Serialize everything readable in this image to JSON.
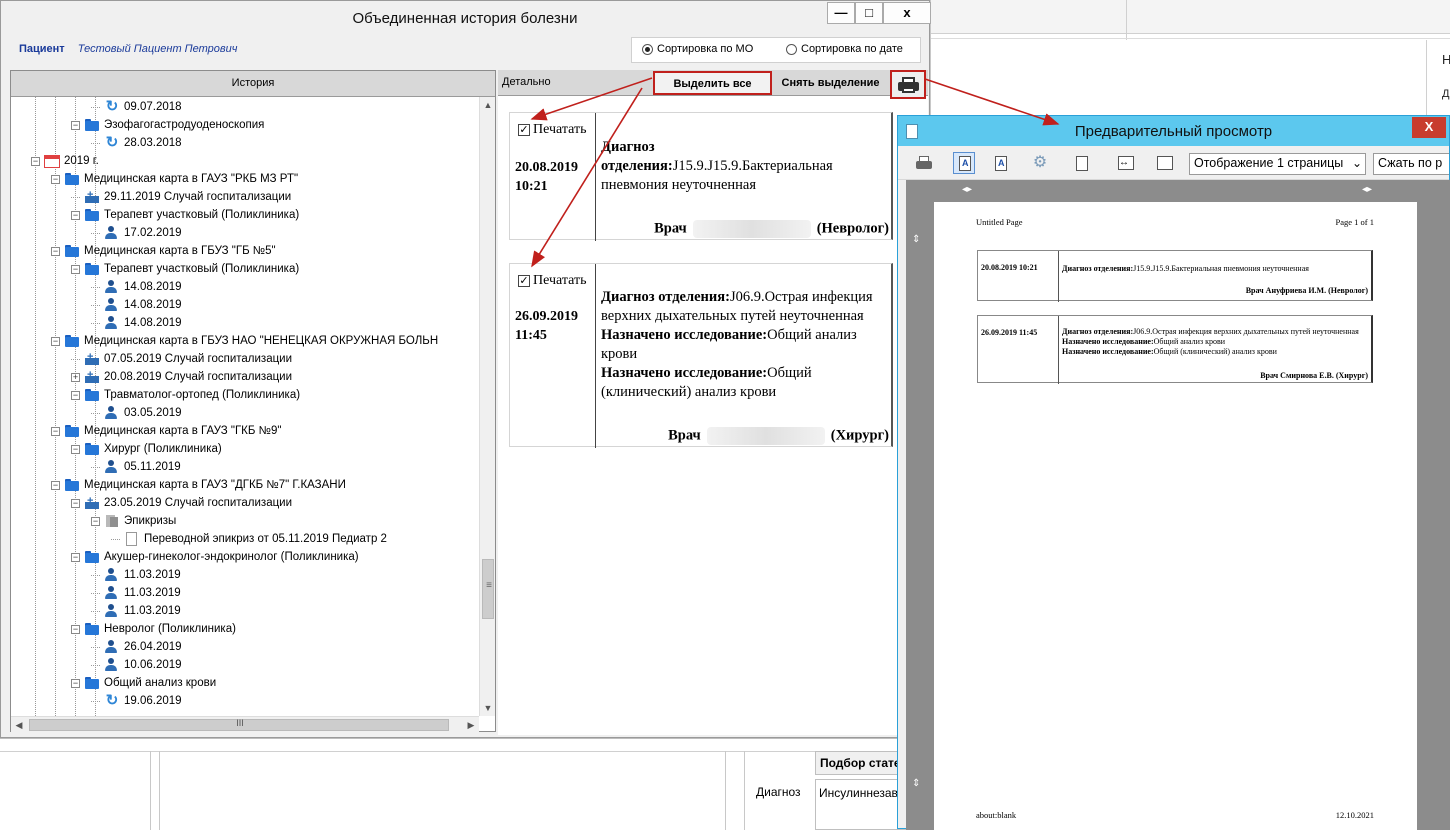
{
  "background": {
    "right_letters": [
      "Н",
      "Д"
    ],
    "bottom_header": "Подбор статей",
    "bottom_label": "Диагноз",
    "bottom_value": "Инсулиннезависимый"
  },
  "main_window": {
    "title": "Объединенная история болезни",
    "controls": {
      "minimize": "—",
      "maximize": "□",
      "close": "x"
    },
    "patient_label": "Пациент",
    "patient_name": "Тестовый Пациент Петрович",
    "sort": {
      "by_mo": "Сортировка по МО",
      "by_date": "Сортировка по дате",
      "selected": "by_mo"
    },
    "history_header": "История",
    "tree": [
      {
        "level": 4,
        "icon": "refresh",
        "text": "09.07.2018"
      },
      {
        "level": 3,
        "icon": "folder",
        "exp": "−",
        "text": "Эзофагогастродуоденоскопия"
      },
      {
        "level": 4,
        "icon": "refresh",
        "text": "28.03.2018"
      },
      {
        "level": 1,
        "icon": "cal",
        "exp": "−",
        "text": "2019 г."
      },
      {
        "level": 2,
        "icon": "folder",
        "exp": "−",
        "text": "Медицинская карта в ГАУЗ \"РКБ МЗ РТ\""
      },
      {
        "level": 3,
        "icon": "hosp",
        "text": "29.11.2019 Случай госпитализации"
      },
      {
        "level": 3,
        "icon": "folder",
        "exp": "−",
        "text": "Терапевт участковый (Поликлиника)"
      },
      {
        "level": 4,
        "icon": "person",
        "text": "17.02.2019"
      },
      {
        "level": 2,
        "icon": "folder",
        "exp": "−",
        "text": "Медицинская карта в ГБУЗ \"ГБ №5\""
      },
      {
        "level": 3,
        "icon": "folder",
        "exp": "−",
        "text": "Терапевт участковый (Поликлиника)"
      },
      {
        "level": 4,
        "icon": "person",
        "text": "14.08.2019"
      },
      {
        "level": 4,
        "icon": "person",
        "text": "14.08.2019"
      },
      {
        "level": 4,
        "icon": "person",
        "text": "14.08.2019"
      },
      {
        "level": 2,
        "icon": "folder",
        "exp": "−",
        "text": "Медицинская карта в ГБУЗ НАО \"НЕНЕЦКАЯ ОКРУЖНАЯ БОЛЬН"
      },
      {
        "level": 3,
        "icon": "hosp",
        "text": "07.05.2019 Случай госпитализации"
      },
      {
        "level": 3,
        "icon": "hosp",
        "exp": "+",
        "text": "20.08.2019 Случай госпитализации"
      },
      {
        "level": 3,
        "icon": "folder",
        "exp": "−",
        "text": "Травматолог-ортопед (Поликлиника)"
      },
      {
        "level": 4,
        "icon": "person",
        "text": "03.05.2019"
      },
      {
        "level": 2,
        "icon": "folder",
        "exp": "−",
        "text": "Медицинская карта в ГАУЗ \"ГКБ №9\""
      },
      {
        "level": 3,
        "icon": "folder",
        "exp": "−",
        "text": "Хирург (Поликлиника)"
      },
      {
        "level": 4,
        "icon": "person",
        "text": "05.11.2019"
      },
      {
        "level": 2,
        "icon": "folder",
        "exp": "−",
        "text": "Медицинская карта в ГАУЗ \"ДГКБ №7\" Г.КАЗАНИ"
      },
      {
        "level": 3,
        "icon": "hosp",
        "exp": "−",
        "text": "23.05.2019 Случай госпитализации"
      },
      {
        "level": 4,
        "icon": "docs",
        "exp": "−",
        "text": "Эпикризы"
      },
      {
        "level": 5,
        "icon": "page",
        "text": "Переводной эпикриз от 05.11.2019 Педиатр 2"
      },
      {
        "level": 3,
        "icon": "folder",
        "exp": "−",
        "text": "Акушер-гинеколог-эндокринолог (Поликлиника)"
      },
      {
        "level": 4,
        "icon": "person",
        "text": "11.03.2019"
      },
      {
        "level": 4,
        "icon": "person",
        "text": "11.03.2019"
      },
      {
        "level": 4,
        "icon": "person",
        "text": "11.03.2019"
      },
      {
        "level": 3,
        "icon": "folder",
        "exp": "−",
        "text": "Невролог (Поликлиника)"
      },
      {
        "level": 4,
        "icon": "person",
        "text": "26.04.2019"
      },
      {
        "level": 4,
        "icon": "person",
        "text": "10.06.2019"
      },
      {
        "level": 3,
        "icon": "folder",
        "exp": "−",
        "text": "Общий анализ крови"
      },
      {
        "level": 4,
        "icon": "refresh",
        "text": "19.06.2019"
      }
    ],
    "hscroll_grip": "III",
    "vscroll_grip": "≡",
    "detail": {
      "header": "Детально",
      "select_all": "Выделить все",
      "clear_selection": "Снять выделение",
      "cards": [
        {
          "print_label": "Печатать",
          "date": "20.08.2019",
          "time": "10:21",
          "lines": [
            {
              "bold": "Диагноз отделения:",
              "text": "J15.9.J15.9.Бактериальная пневмония неуточненная"
            }
          ],
          "doctor_prefix": "Врач",
          "doctor_role": "(Невролог)"
        },
        {
          "print_label": "Печатать",
          "date": "26.09.2019",
          "time": "11:45",
          "lines": [
            {
              "bold": "Диагноз отделения:",
              "text": "J06.9.Острая инфекция верхних дыхательных путей неуточненная"
            },
            {
              "bold": "Назначено исследование:",
              "text": "Общий анализ крови"
            },
            {
              "bold": "Назначено исследование:",
              "text": "Общий (клинический) анализ крови"
            }
          ],
          "doctor_prefix": "Врач",
          "doctor_role": "(Хирург)"
        }
      ]
    }
  },
  "preview": {
    "title": "Предварительный просмотр",
    "close": "X",
    "view_mode": "Отображение 1 страницы",
    "fit_mode": "Сжать по р",
    "page_header_left": "Untitled Page",
    "page_header_right": "Page 1 of 1",
    "page_footer_left": "about:blank",
    "page_footer_right": "12.10.2021",
    "entries": [
      {
        "datetime": "20.08.2019 10:21",
        "lines": [
          {
            "bold": "Диагноз отделения:",
            "text": "J15.9.J15.9.Бактериальная пневмония неуточненная"
          }
        ],
        "doctor": "Врач Ануфриева И.М. (Невролог)"
      },
      {
        "datetime": "26.09.2019 11:45",
        "lines": [
          {
            "bold": "Диагноз отделения:",
            "text": "J06.9.Острая инфекция верхних дыхательных путей неуточненная"
          },
          {
            "bold": "Назначено исследование:",
            "text": "Общий анализ крови"
          },
          {
            "bold": "Назначено исследование:",
            "text": "Общий (клинический) анализ крови"
          }
        ],
        "doctor": "Врач Смирнова Е.В. (Хирург)"
      }
    ]
  },
  "colors": {
    "annotation_red": "#c0201c",
    "preview_title": "#5cc8ee",
    "link_blue": "#1a3a9a"
  }
}
